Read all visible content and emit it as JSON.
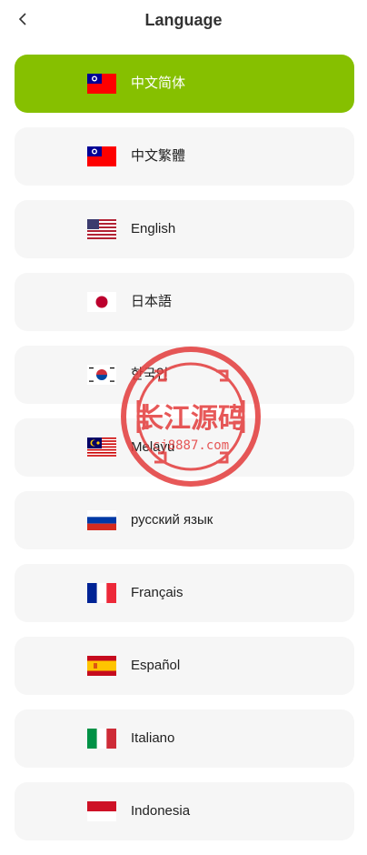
{
  "header": {
    "title": "Language",
    "back_icon": "chevron-left-icon"
  },
  "languages": [
    {
      "label": "中文简体",
      "flag": "flag-taiwan",
      "selected": true
    },
    {
      "label": "中文繁體",
      "flag": "flag-taiwan",
      "selected": false
    },
    {
      "label": "English",
      "flag": "flag-usa",
      "selected": false
    },
    {
      "label": "日本語",
      "flag": "flag-japan",
      "selected": false
    },
    {
      "label": "한국인",
      "flag": "flag-korea",
      "selected": false
    },
    {
      "label": "Melayu",
      "flag": "flag-malaysia",
      "selected": false
    },
    {
      "label": "русский язык",
      "flag": "flag-russia",
      "selected": false
    },
    {
      "label": "Français",
      "flag": "flag-france",
      "selected": false
    },
    {
      "label": "Español",
      "flag": "flag-spain",
      "selected": false
    },
    {
      "label": "Italiano",
      "flag": "flag-italy",
      "selected": false
    },
    {
      "label": "Indonesia",
      "flag": "flag-indonesia",
      "selected": false
    }
  ],
  "watermark": {
    "text": "长江源码",
    "url": "cj8887.com"
  },
  "colors": {
    "accent": "#86c000",
    "item_bg": "#f6f6f6",
    "watermark": "#e33b3b"
  }
}
